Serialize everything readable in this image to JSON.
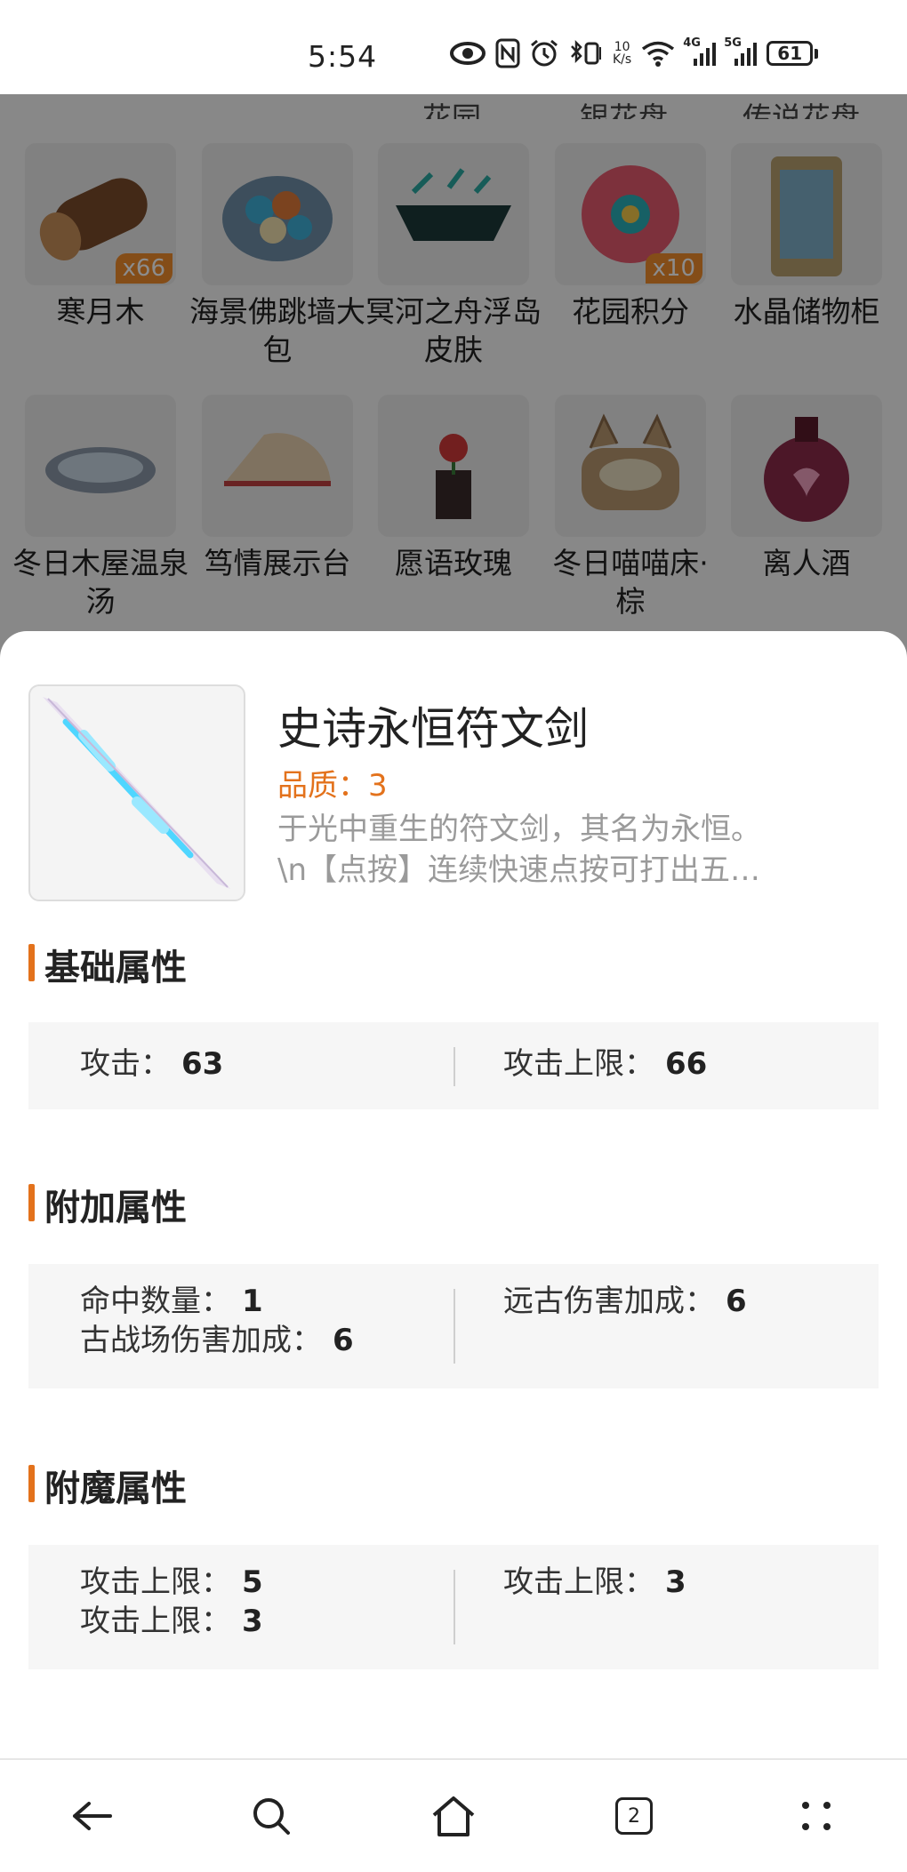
{
  "status_bar": {
    "time": "5:54",
    "network_speed": "10\nK/s",
    "signal_1": "4G",
    "signal_2": "5G",
    "battery": "61"
  },
  "background_grid": {
    "cut_labels": [
      "花园",
      "银花盘",
      "传说花盘"
    ],
    "rows": [
      [
        {
          "name": "寒月木",
          "badge": "x66"
        },
        {
          "name": "海景佛跳墙大包",
          "badge": ""
        },
        {
          "name": "冥河之舟浮岛皮肤",
          "badge": ""
        },
        {
          "name": "花园积分",
          "badge": "x10"
        },
        {
          "name": "水晶储物柜",
          "badge": ""
        }
      ],
      [
        {
          "name": "冬日木屋温泉汤",
          "badge": ""
        },
        {
          "name": "笃情展示台",
          "badge": ""
        },
        {
          "name": "愿语玫瑰",
          "badge": ""
        },
        {
          "name": "冬日喵喵床·棕",
          "badge": ""
        },
        {
          "name": "离人酒",
          "badge": ""
        }
      ]
    ]
  },
  "item": {
    "title": "史诗永恒符文剑",
    "quality": "品质：3",
    "desc_line1": "于光中重生的符文剑，其名为永恒。",
    "desc_line2": "\\n【点按】连续快速点按可打出五…"
  },
  "sections": {
    "base": {
      "title": "基础属性",
      "left": [
        {
          "label": "攻击：",
          "value": "63"
        }
      ],
      "right": [
        {
          "label": "攻击上限：",
          "value": "66"
        }
      ]
    },
    "extra": {
      "title": "附加属性",
      "left": [
        {
          "label": "命中数量：",
          "value": "1"
        },
        {
          "label": "古战场伤害加成：",
          "value": "6"
        }
      ],
      "right": [
        {
          "label": "远古伤害加成：",
          "value": "6"
        }
      ]
    },
    "enchant": {
      "title": "附魔属性",
      "left": [
        {
          "label": "攻击上限：",
          "value": "5"
        },
        {
          "label": "攻击上限：",
          "value": "3"
        }
      ],
      "right": [
        {
          "label": "攻击上限：",
          "value": "3"
        }
      ]
    }
  },
  "navbar": {
    "tabs_count": "2"
  }
}
